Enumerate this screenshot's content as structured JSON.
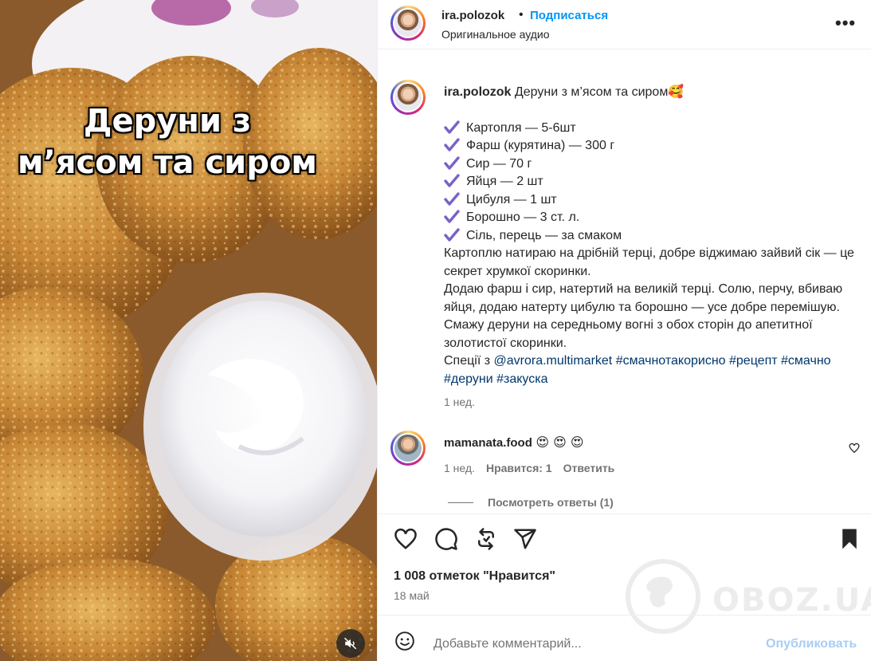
{
  "media": {
    "overlay_line1": "Деруни з",
    "overlay_line2": "м’ясом та сиром",
    "mute_icon": "speaker-muted-icon"
  },
  "header": {
    "username": "ira.polozok",
    "separator": "•",
    "follow_label": "Подписаться",
    "audio_label": "Оригинальное аудио",
    "more_label": "•••"
  },
  "caption": {
    "username": "ira.polozok",
    "title": "Деруни з м’ясом та сиром🥰",
    "ingredients": [
      "Картопля — 5-6шт",
      "Фарш (курятина) — 300 г",
      "Сир — 70 г",
      "Яйця — 2 шт",
      "Цибуля — 1 шт",
      "Борошно — 3 ст. л.",
      "Сіль, перець — за смаком"
    ],
    "paragraph1": "Картоплю натираю на дрібній терці, добре віджимаю зайвий сік — це секрет хрумкої скоринки.",
    "paragraph2": "Додаю фарш і сир, натертий на великій терці. Солю, перчу, вбиваю яйця, додаю натерту цибулю та борошно — усе добре перемішую. Смажу деруни на середньому вогні з обох сторін до апетитної золотистої скоринки.",
    "spices_prefix": "Спеції з ",
    "mention": "@avrora.multimarket",
    "hashtag1": "#смачнотакорисно",
    "hashtag2": "#рецепт",
    "hashtag3": "#смачно",
    "hashtag4": "#деруни",
    "hashtag5": "#закуска",
    "time": "1 нед."
  },
  "comment": {
    "username": "mamanata.food",
    "text": "😍 😍 😍",
    "time": "1 нед.",
    "likes": "Нравится: 1",
    "reply": "Ответить",
    "view_replies": "Посмотреть ответы (1)"
  },
  "stats": {
    "likes": "1 008 отметок \"Нравится\"",
    "date": "18 май"
  },
  "add_comment": {
    "placeholder": "Добавьте комментарий...",
    "publish": "Опубликовать"
  },
  "watermark": {
    "text": "OBOZ.UA"
  },
  "colors": {
    "accent": "#0095f6",
    "check": "#7b61c9",
    "link": "#00376b",
    "muted": "#737373"
  }
}
